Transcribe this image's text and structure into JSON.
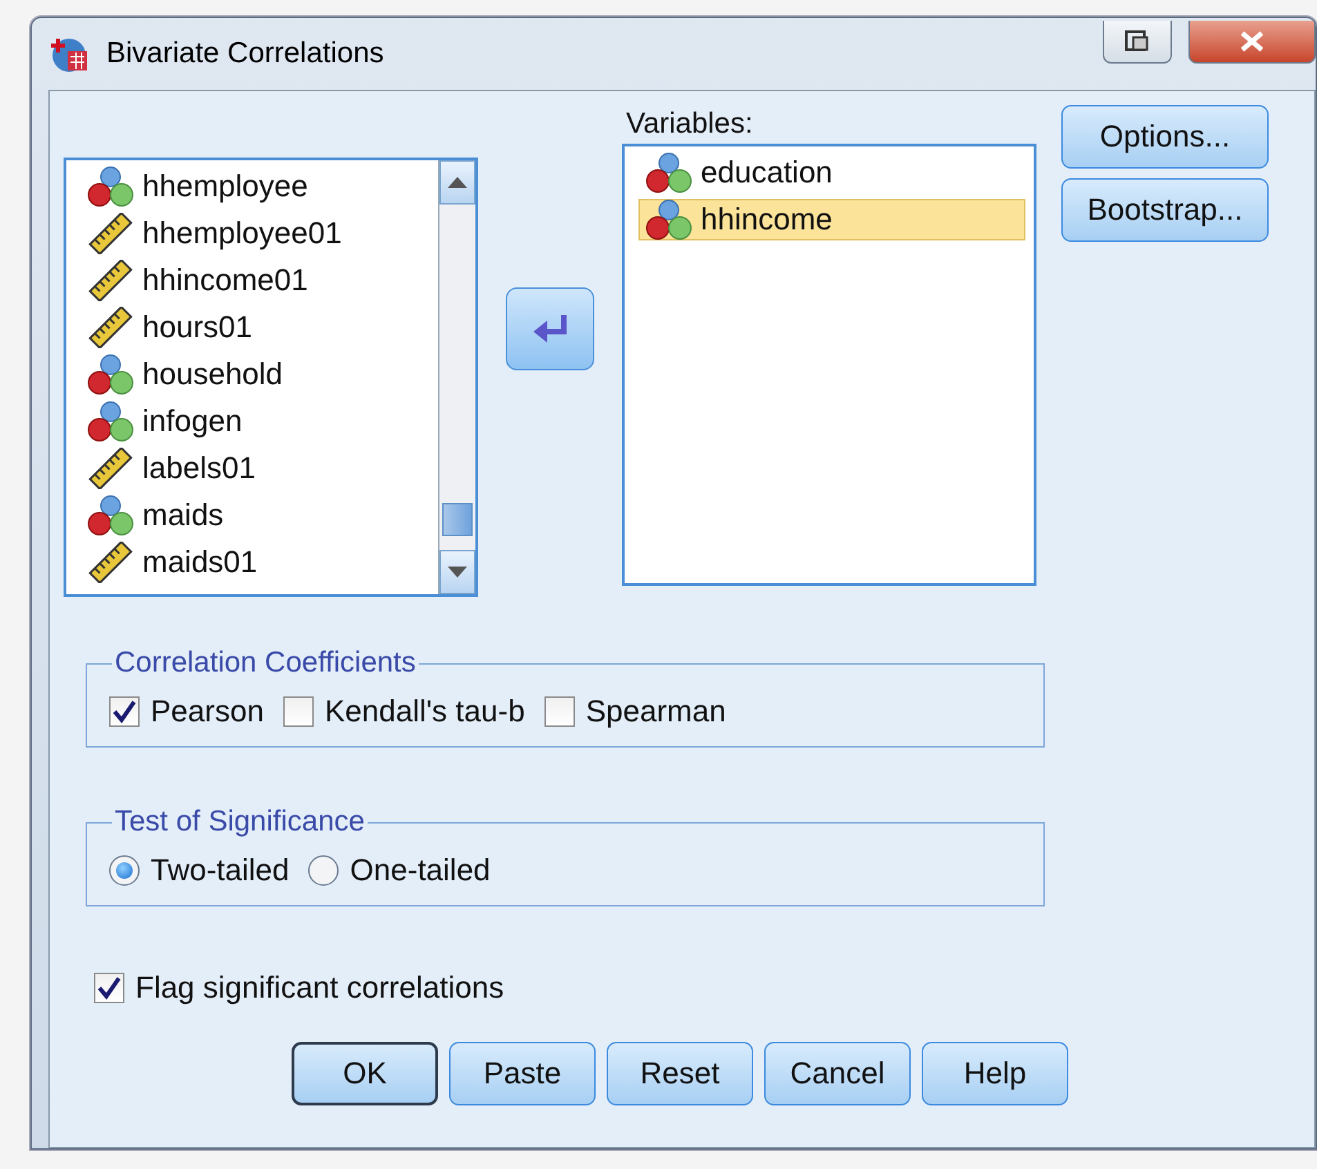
{
  "window": {
    "title": "Bivariate Correlations"
  },
  "source_list": {
    "items": [
      {
        "name": "hhemployee",
        "kind": "nominal"
      },
      {
        "name": "hhemployee01",
        "kind": "scale"
      },
      {
        "name": "hhincome01",
        "kind": "scale"
      },
      {
        "name": "hours01",
        "kind": "scale"
      },
      {
        "name": "household",
        "kind": "nominal"
      },
      {
        "name": "infogen",
        "kind": "nominal"
      },
      {
        "name": "labels01",
        "kind": "scale"
      },
      {
        "name": "maids",
        "kind": "nominal"
      },
      {
        "name": "maids01",
        "kind": "scale"
      }
    ]
  },
  "variables": {
    "label": "Variables:",
    "items": [
      {
        "name": "education",
        "kind": "nominal",
        "selected": false
      },
      {
        "name": "hhincome",
        "kind": "nominal",
        "selected": true
      }
    ]
  },
  "side_buttons": [
    "Options...",
    "Bootstrap..."
  ],
  "correlation_coefficients": {
    "title": "Correlation Coefficients",
    "options": [
      {
        "label": "Pearson",
        "checked": true
      },
      {
        "label": "Kendall's tau-b",
        "checked": false
      },
      {
        "label": "Spearman",
        "checked": false
      }
    ]
  },
  "test_of_significance": {
    "title": "Test of Significance",
    "options": [
      {
        "label": "Two-tailed",
        "selected": true
      },
      {
        "label": "One-tailed",
        "selected": false
      }
    ]
  },
  "flag": {
    "label": "Flag significant correlations",
    "checked": true
  },
  "buttons": [
    {
      "label": "OK",
      "default": true
    },
    {
      "label": "Paste",
      "default": false
    },
    {
      "label": "Reset",
      "default": false
    },
    {
      "label": "Cancel",
      "default": false
    },
    {
      "label": "Help",
      "default": false
    }
  ]
}
